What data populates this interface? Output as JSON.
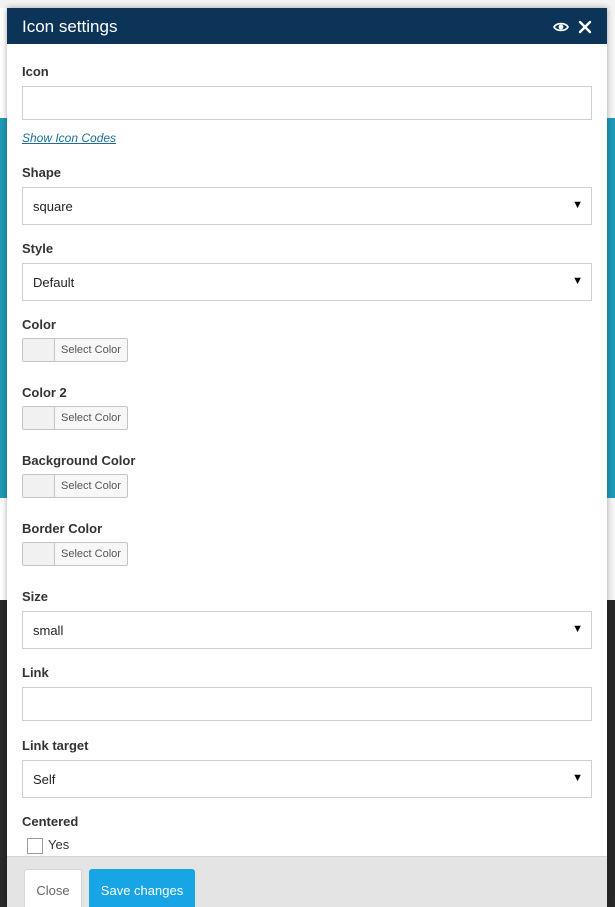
{
  "modal": {
    "title": "Icon settings"
  },
  "fields": {
    "icon": {
      "label": "Icon",
      "value": "",
      "placeholder": ""
    },
    "show_icon_codes": "Show Icon Codes",
    "shape": {
      "label": "Shape",
      "value": "square"
    },
    "style": {
      "label": "Style",
      "value": "Default"
    },
    "color": {
      "label": "Color",
      "button": "Select Color"
    },
    "color2": {
      "label": "Color 2",
      "button": "Select Color"
    },
    "background_color": {
      "label": "Background Color",
      "button": "Select Color"
    },
    "border_color": {
      "label": "Border Color",
      "button": "Select Color"
    },
    "size": {
      "label": "Size",
      "value": "small"
    },
    "link": {
      "label": "Link",
      "value": "",
      "placeholder": ""
    },
    "link_target": {
      "label": "Link target",
      "value": "Self"
    },
    "centered": {
      "label": "Centered",
      "option": "Yes",
      "checked": false
    }
  },
  "footer": {
    "close_label": "Close",
    "save_label": "Save changes"
  },
  "icons": {
    "header_preview": "eye-icon",
    "header_close": "close-icon",
    "select_arrow": "caret-down-icon"
  },
  "colors": {
    "header_bg": "#0b3458",
    "primary_button": "#17a5e6",
    "link": "#1a6f98"
  }
}
